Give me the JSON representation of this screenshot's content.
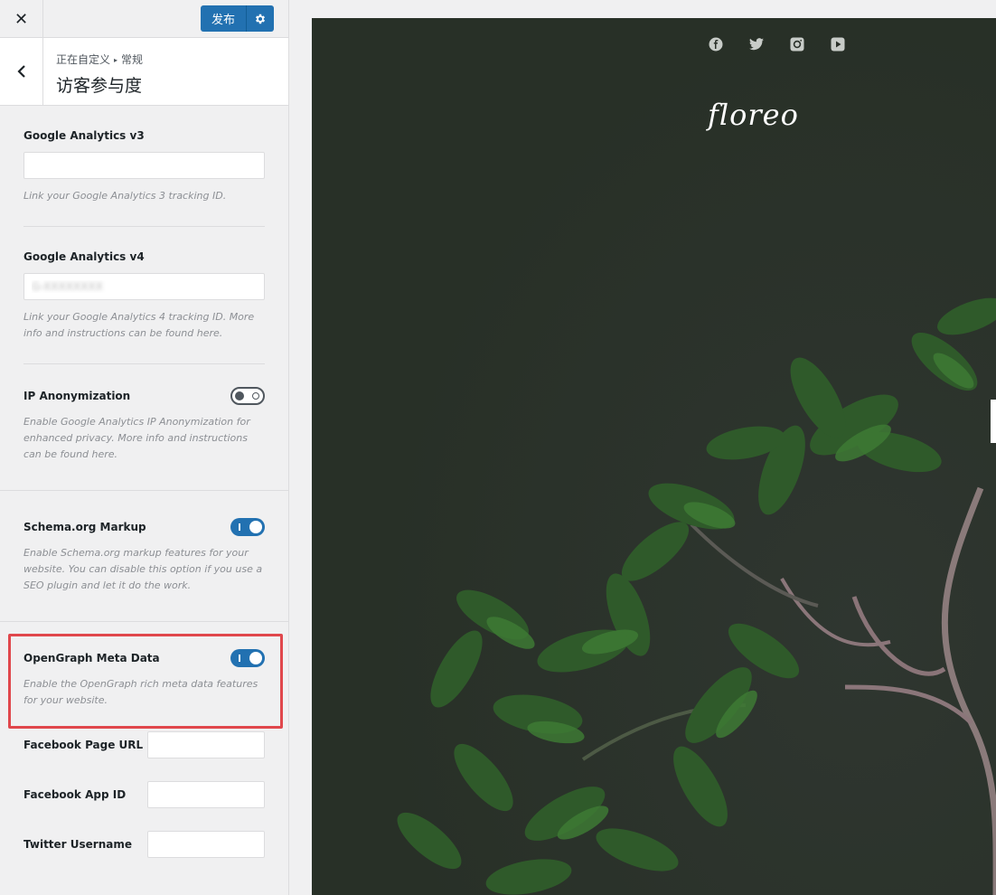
{
  "topbar": {
    "close_glyph": "✕",
    "publish_label": "发布"
  },
  "breadcrumb": {
    "prefix": "正在自定义",
    "separator": "▸",
    "parent": "常规"
  },
  "section_title": "访客参与度",
  "ga3": {
    "label": "Google Analytics v3",
    "value": "",
    "description": "Link your Google Analytics 3 tracking ID."
  },
  "ga4": {
    "label": "Google Analytics v4",
    "value": "G-XXXXXXXX",
    "description": "Link your Google Analytics 4 tracking ID. More info and instructions can be found here."
  },
  "ip_anonymization": {
    "label": "IP Anonymization",
    "enabled": false,
    "description": "Enable Google Analytics IP Anonymization for enhanced privacy. More info and instructions can be found here."
  },
  "schema": {
    "label": "Schema.org Markup",
    "enabled": true,
    "description": "Enable Schema.org markup features for your website. You can disable this option if you use a SEO plugin and let it do the work."
  },
  "opengraph": {
    "label": "OpenGraph Meta Data",
    "enabled": true,
    "description": "Enable the OpenGraph rich meta data features for your website."
  },
  "facebook_page": {
    "label": "Facebook Page URL",
    "value": ""
  },
  "facebook_app": {
    "label": "Facebook App ID",
    "value": ""
  },
  "twitter": {
    "label": "Twitter Username",
    "value": ""
  },
  "preview": {
    "logo_text": "floreo",
    "social_icons": [
      "facebook-icon",
      "twitter-icon",
      "instagram-icon",
      "youtube-icon"
    ]
  },
  "colors": {
    "accent": "#2271b1",
    "highlight": "#e0474c",
    "preview_bg": "#2a3029"
  }
}
